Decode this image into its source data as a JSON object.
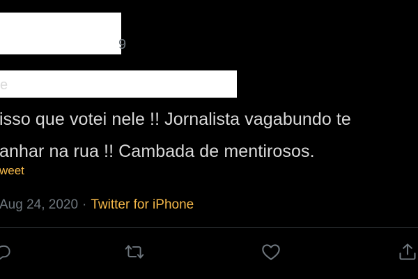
{
  "tweet": {
    "text_lines": [
      "isso que votei nele !! Jornalista vagabundo te",
      "anhar na rua !! Cambada de mentirosos."
    ],
    "translate_label": "weet",
    "timestamp": "Aug 24, 2020",
    "separator": "·",
    "source": "Twitter for iPhone",
    "leak_chars": {
      "handle_tail": "9",
      "mention_tail": "e"
    }
  },
  "actions": [
    {
      "icon": "reply-icon"
    },
    {
      "icon": "retweet-icon"
    },
    {
      "icon": "like-icon"
    },
    {
      "icon": "share-icon"
    }
  ],
  "colors": {
    "background": "#000000",
    "text": "#d9d9d9",
    "muted": "#6e767d",
    "accent": "#f6b94a",
    "divider": "#2f3336",
    "redaction": "#ffffff"
  }
}
